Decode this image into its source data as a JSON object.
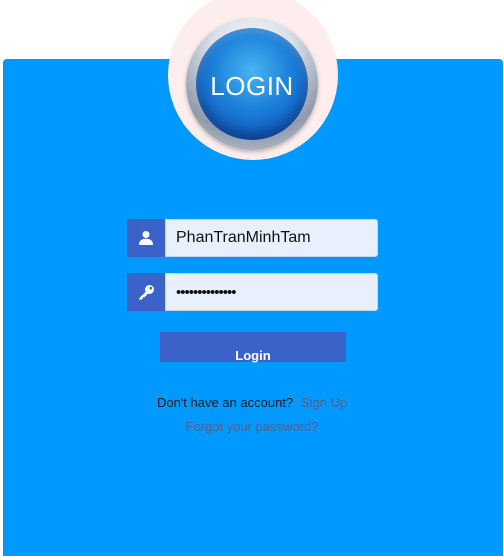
{
  "logo": {
    "text": "LOGIN",
    "icon": "login-badge"
  },
  "form": {
    "username": {
      "value": "PhanTranMinhTam",
      "icon": "user-icon"
    },
    "password": {
      "value": "••••••••••••••",
      "icon": "key-icon"
    },
    "submit_label": "Login"
  },
  "footer": {
    "no_account_text": "Don't have an account?",
    "signup_label": "Sign Up",
    "forgot_label": "Forgot your password?"
  },
  "colors": {
    "panel_background": "#0099ff",
    "accent": "#3a62c8",
    "input_background": "#e8f0fe",
    "link": "#5d5d8a"
  }
}
